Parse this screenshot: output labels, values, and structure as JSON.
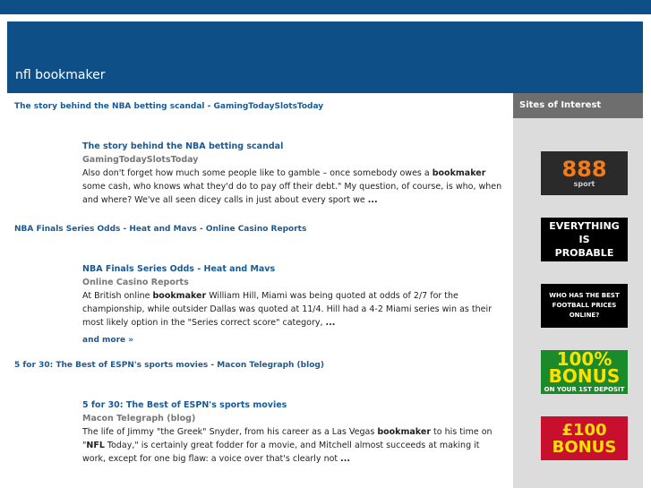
{
  "header": {
    "title": "nfl bookmaker"
  },
  "results": [
    {
      "heading": "The story behind the NBA betting scandal - GamingTodaySlotsToday",
      "title": "The story behind the NBA betting scandal",
      "source": "GamingTodaySlotsToday",
      "snippet_before": "Also don't forget how much some people like to gamble – once somebody owes a ",
      "snippet_bold": "bookmaker",
      "snippet_after": " some cash, who knows what they'd do to pay off their debt.\" My question, of course, is who, when and where? We've all seen dicey calls in just about every sport we ",
      "ellipsis": "..."
    },
    {
      "heading": "NBA Finals Series Odds - Heat and Mavs - Online Casino Reports",
      "title": "NBA Finals Series Odds - Heat and Mavs",
      "source": "Online Casino Reports",
      "snippet_before": "At British online ",
      "snippet_bold": "bookmaker",
      "snippet_after": " William Hill, Miami was being quoted at odds of 2/7 for the championship, while outsider Dallas was quoted at 11/4. Hill had a 4-2 Miami series win as their most likely option in the \"Series correct score\" category, ",
      "ellipsis": "..."
    },
    {
      "heading": "5 for 30: The Best of ESPN's sports movies - Macon Telegraph (blog)",
      "title": "5 for 30: The Best of ESPN's sports movies",
      "source": "Macon Telegraph (blog)",
      "snippet_before": "The life of Jimmy \"the Greek\" Snyder, from his career as a Las Vegas ",
      "snippet_bold": "bookmaker",
      "snippet_mid": " to his time on \"",
      "snippet_bold2": "NFL",
      "snippet_after": " Today,\" is certainly great fodder for a movie, and Mitchell almost succeeds at making it work, except for one big flaw: a voice over that's clearly not ",
      "ellipsis": "..."
    }
  ],
  "more_label": "and more »",
  "sidebar": {
    "title": "Sites of Interest",
    "ads": {
      "ad1_big": "888",
      "ad1_small": "sport",
      "ad2_line1": "EVERYTHING",
      "ad2_line2": "IS",
      "ad2_line3": "PROBABLE",
      "ad3_line1": "WHO HAS THE BEST",
      "ad3_line2": "FOOTBALL PRICES",
      "ad3_line3": "ONLINE?",
      "ad4_big1": "100%",
      "ad4_big2": "BONUS",
      "ad4_small": "ON YOUR 1ST DEPOSIT",
      "ad5_big1": "£100",
      "ad5_big2": "BONUS"
    }
  },
  "colors": {
    "header_bg": "#0d4f86",
    "link": "#1a5a94",
    "sidebar_bg": "#dcdcdc",
    "sidebar_head": "#6e6e6e"
  }
}
